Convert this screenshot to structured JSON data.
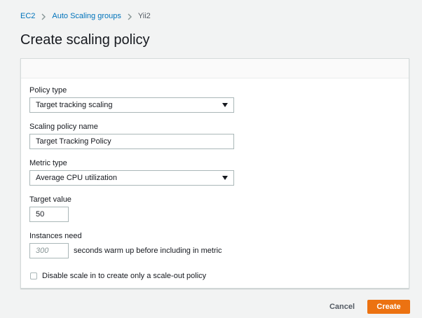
{
  "breadcrumb": {
    "items": [
      {
        "label": "EC2"
      },
      {
        "label": "Auto Scaling groups"
      },
      {
        "label": "Yii2"
      }
    ]
  },
  "page": {
    "title": "Create scaling policy"
  },
  "form": {
    "policy_type": {
      "label": "Policy type",
      "value": "Target tracking scaling"
    },
    "policy_name": {
      "label": "Scaling policy name",
      "value": "Target Tracking Policy"
    },
    "metric_type": {
      "label": "Metric type",
      "value": "Average CPU utilization"
    },
    "target_value": {
      "label": "Target value",
      "value": "50"
    },
    "instances_need": {
      "label": "Instances need",
      "placeholder": "300",
      "suffix": "seconds warm up before including in metric"
    },
    "disable_scale_in": {
      "label": "Disable scale in to create only a scale-out policy",
      "checked": false
    }
  },
  "footer": {
    "cancel_label": "Cancel",
    "create_label": "Create"
  },
  "colors": {
    "link": "#0073bb",
    "primary": "#ec7211",
    "background": "#f2f3f3"
  }
}
